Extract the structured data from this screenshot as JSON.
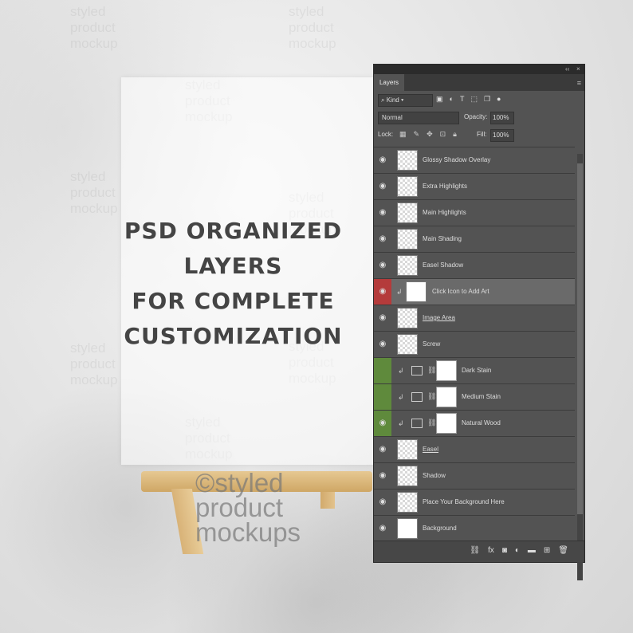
{
  "promo": {
    "line1": "PSD ORGANIZED LAYERS",
    "line2": "FOR COMPLETE",
    "line3": "CUSTOMIZATION"
  },
  "watermark": {
    "copyright_line1": "©styled",
    "copyright_line2": "product",
    "copyright_line3": "mockups",
    "small_word1": "styled",
    "small_word2": "product",
    "small_word3": "mockup"
  },
  "panel": {
    "collapse_glyph": "‹‹",
    "close_glyph": "×",
    "tab_label": "Layers",
    "kind_label": "Kind",
    "blend_mode": "Normal",
    "opacity_label": "Opacity:",
    "opacity_value": "100%",
    "lock_label": "Lock:",
    "fill_label": "Fill:",
    "fill_value": "100%",
    "layers": [
      {
        "name": "Glossy Shadow Overlay"
      },
      {
        "name": "Extra Highlights"
      },
      {
        "name": "Main Highlights"
      },
      {
        "name": "Main Shading"
      },
      {
        "name": "Easel Shadow"
      },
      {
        "name": "Click Icon to Add Art"
      },
      {
        "name": "Image Area"
      },
      {
        "name": "Screw"
      },
      {
        "name": "Dark Stain"
      },
      {
        "name": "Medium Stain"
      },
      {
        "name": "Natural Wood"
      },
      {
        "name": "Easel"
      },
      {
        "name": "Shadow"
      },
      {
        "name": "Place Your Background Here"
      },
      {
        "name": "Background"
      }
    ]
  },
  "colors": {
    "panel_bg": "#535353",
    "selected_eye": "#b43b3b",
    "stain_eye": "#5f8a3c"
  }
}
